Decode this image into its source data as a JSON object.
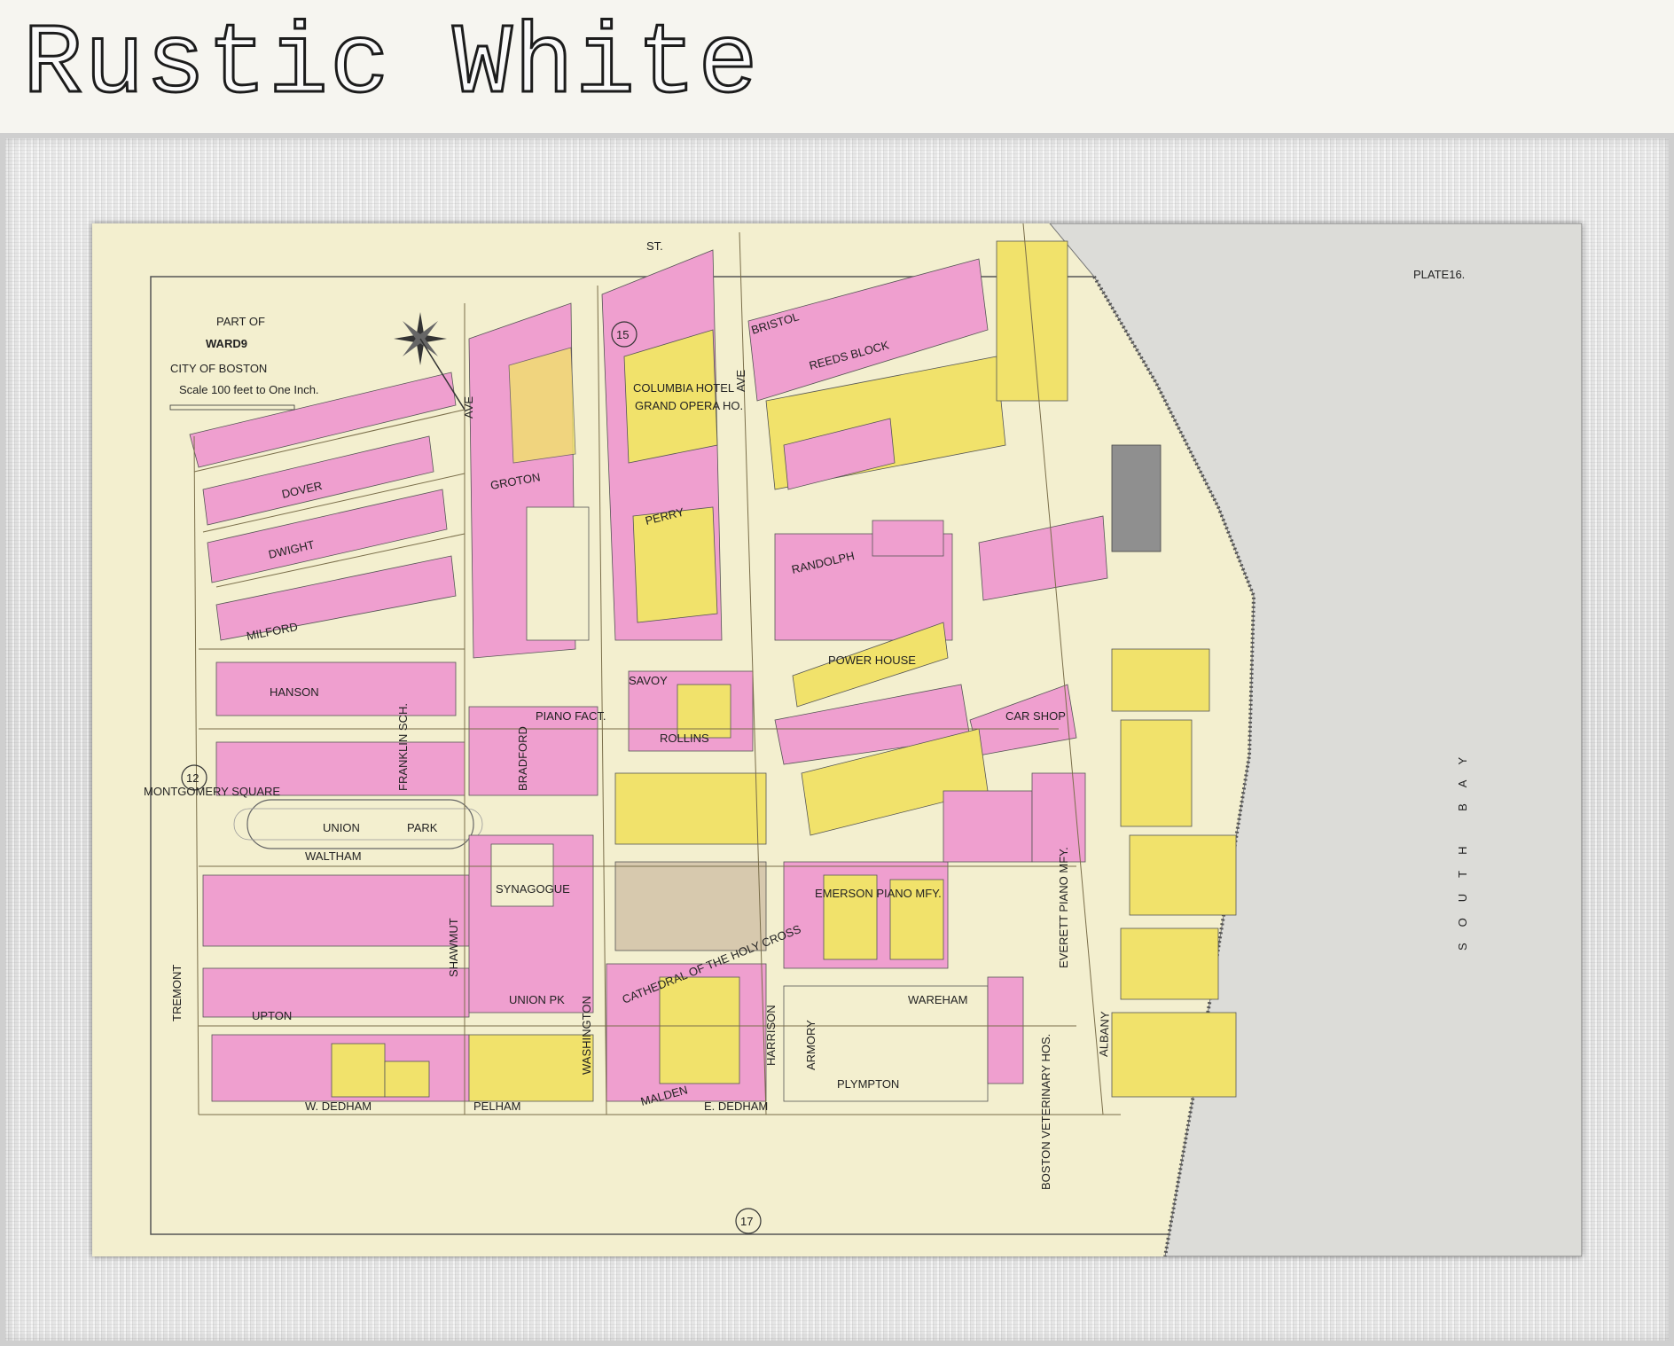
{
  "banner": {
    "title": "Rustic White"
  },
  "map": {
    "plate": "PLATE16.",
    "title": {
      "line1": "PART OF",
      "line2": "WARD9",
      "line3": "CITY OF BOSTON"
    },
    "scale_text": "Scale 100 feet to One Inch.",
    "ward_numbers": [
      "15",
      "12",
      "17"
    ],
    "water_label": "SOUTH BAY",
    "colors": {
      "paper": "#f3efcf",
      "brick": "#ef9fcf",
      "wood": "#f1e26b",
      "street": "#efe6bf",
      "water": "#d9d9d4"
    },
    "streets": {
      "dover": "DOVER",
      "dwight": "DWIGHT",
      "milford": "MILFORD",
      "hanson": "HANSON",
      "waltham": "WALTHAM",
      "union_pk": "UNION PK",
      "union_park": "UNION",
      "park": "PARK",
      "upton": "UPTON",
      "w_dedham": "W. DEDHAM",
      "e_dedham": "E. DEDHAM",
      "tremont": "TREMONT",
      "shawmut": "SHAWMUT",
      "washington": "WASHINGTON",
      "harrison": "HARRISON",
      "albany": "ALBANY",
      "bristol": "BRISTOL",
      "randolph": "RANDOLPH",
      "wareham": "WAREHAM",
      "plympton": "PLYMPTON",
      "malden": "MALDEN",
      "pelham": "PELHAM",
      "rollins": "ROLLINS",
      "savoy": "SAVOY",
      "perry": "PERRY",
      "groton": "GROTON",
      "bradford": "BRADFORD",
      "ave": "AVE",
      "st": "ST.",
      "montgomery_sq": "MONTGOMERY SQUARE"
    },
    "buildings": {
      "power_house": "POWER HOUSE",
      "emerson_piano": "EMERSON PIANO MFY.",
      "cathedral": "CATHEDRAL OF THE HOLY CROSS",
      "grand_opera": "GRAND OPERA HO.",
      "columbia_hotel": "COLUMBIA HOTEL",
      "franklin_sch": "FRANKLIN SCH.",
      "car_shop": "CAR SHOP",
      "armory": "ARMORY",
      "boston_veterinary": "BOSTON VETERINARY HOS.",
      "everett_piano": "EVERETT PIANO MFY.",
      "reeds_block": "REEDS BLOCK",
      "synagogue": "SYNAGOGUE",
      "piano_fact": "PIANO FACT."
    }
  }
}
